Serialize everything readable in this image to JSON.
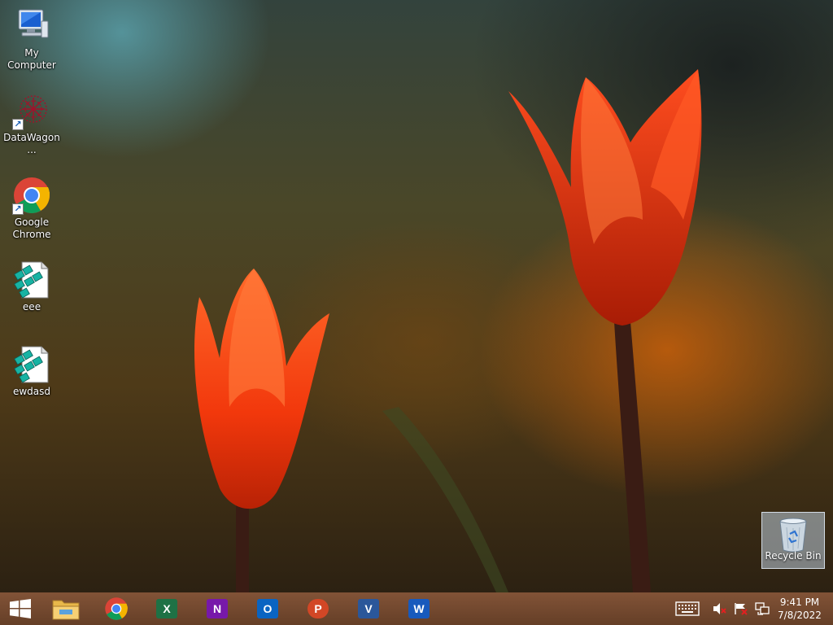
{
  "desktop": {
    "icons": [
      {
        "label": "My Computer",
        "icon": "computer-icon"
      },
      {
        "label": "DataWagon...",
        "icon": "datawagon-icon"
      },
      {
        "label": "Google Chrome",
        "icon": "chrome-icon"
      },
      {
        "label": "eee",
        "icon": "registry-file-icon"
      },
      {
        "label": "ewdasd",
        "icon": "registry-file-icon"
      }
    ],
    "recycle_bin": {
      "label": "Recycle Bin",
      "icon": "recycle-bin-icon"
    }
  },
  "taskbar": {
    "pinned": [
      {
        "name": "File Explorer",
        "icon": "folder-icon"
      },
      {
        "name": "Google Chrome",
        "icon": "chrome-icon"
      },
      {
        "name": "Excel",
        "icon": "excel-icon",
        "letter": "X",
        "color": "#1e7145"
      },
      {
        "name": "OneNote",
        "icon": "onenote-icon",
        "letter": "N",
        "color": "#7719aa"
      },
      {
        "name": "Outlook",
        "icon": "outlook-icon",
        "letter": "O",
        "color": "#0a64c2"
      },
      {
        "name": "PowerPoint",
        "icon": "powerpoint-icon",
        "letter": "P",
        "color": "#d24726"
      },
      {
        "name": "Visio",
        "icon": "visio-icon",
        "letter": "V",
        "color": "#2b579a"
      },
      {
        "name": "Word",
        "icon": "word-icon",
        "letter": "W",
        "color": "#185abd"
      }
    ],
    "tray": {
      "time": "9:41 PM",
      "date": "7/8/2022"
    }
  }
}
